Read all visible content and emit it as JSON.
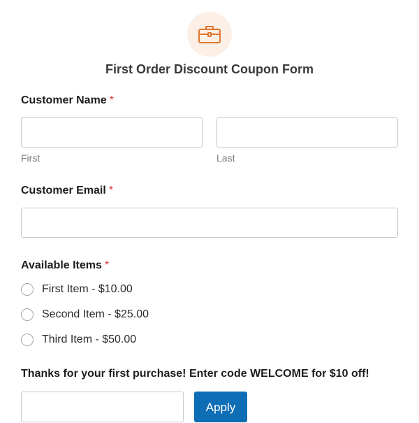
{
  "form": {
    "title": "First Order Discount Coupon Form",
    "icon": "briefcase-icon",
    "accent_color": "#e27730",
    "icon_bg_color": "#fcefe6"
  },
  "customer_name": {
    "label": "Customer Name",
    "required_mark": "*",
    "first": {
      "value": "",
      "sublabel": "First"
    },
    "last": {
      "value": "",
      "sublabel": "Last"
    }
  },
  "customer_email": {
    "label": "Customer Email",
    "required_mark": "*",
    "value": ""
  },
  "available_items": {
    "label": "Available Items",
    "required_mark": "*",
    "options": [
      {
        "label": "First Item - $10.00",
        "checked": false
      },
      {
        "label": "Second Item - $25.00",
        "checked": false
      },
      {
        "label": "Third Item - $50.00",
        "checked": false
      }
    ]
  },
  "coupon": {
    "message": "Thanks for your first purchase! Enter code WELCOME for $10 off!",
    "value": "",
    "apply_label": "Apply",
    "button_color": "#0e6eb5"
  }
}
